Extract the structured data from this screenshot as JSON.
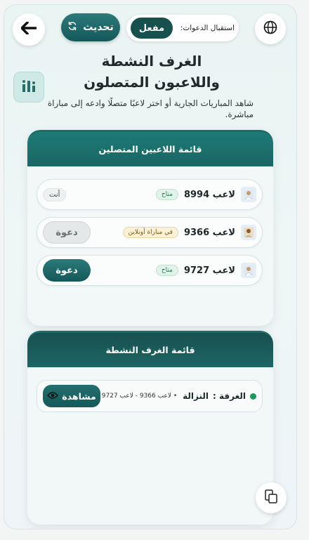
{
  "header": {
    "refresh_label": "تحديث",
    "invites_label": "استقبال الدعوات:",
    "invites_toggle_label": "مفعل"
  },
  "title": {
    "line1": "الغرف النشطة",
    "line2": "واللاعبون المتصلون"
  },
  "subtitle": "شاهد المباريات الجارية أو اختر لاعبًا متصلًا وادعه إلى مباراة مباشرة.",
  "players_card": {
    "header": "قائمة اللاعبين المتصلين",
    "players": [
      {
        "name": "لاعب 8994",
        "status": "متاح",
        "action": "أنت"
      },
      {
        "name": "لاعب 9366",
        "status": "في مباراة أونلاين",
        "action": "دعوة"
      },
      {
        "name": "لاعب 9727",
        "status": "متاح",
        "action": "دعوة"
      }
    ]
  },
  "rooms_card": {
    "header": "قائمة الغرف النشطة",
    "rooms": [
      {
        "label": "الغرفة :",
        "name": "النزالة",
        "players": "• لاعب 9366 - لاعب 9727",
        "action": "مشاهدة"
      }
    ]
  },
  "colors": {
    "primary": "#1a6663",
    "primary_dark": "#16504f",
    "status_free": "#2f7a52",
    "status_busy": "#7a5a17",
    "live": "#1d9a5a"
  },
  "icons": {
    "back": "arrow-left-icon",
    "globe": "globe-icon",
    "refresh": "refresh-icon",
    "stats": "bar-chart-icon",
    "avatar": "player-avatar-icon",
    "watch": "eye-icon",
    "float": "switch-icon"
  }
}
